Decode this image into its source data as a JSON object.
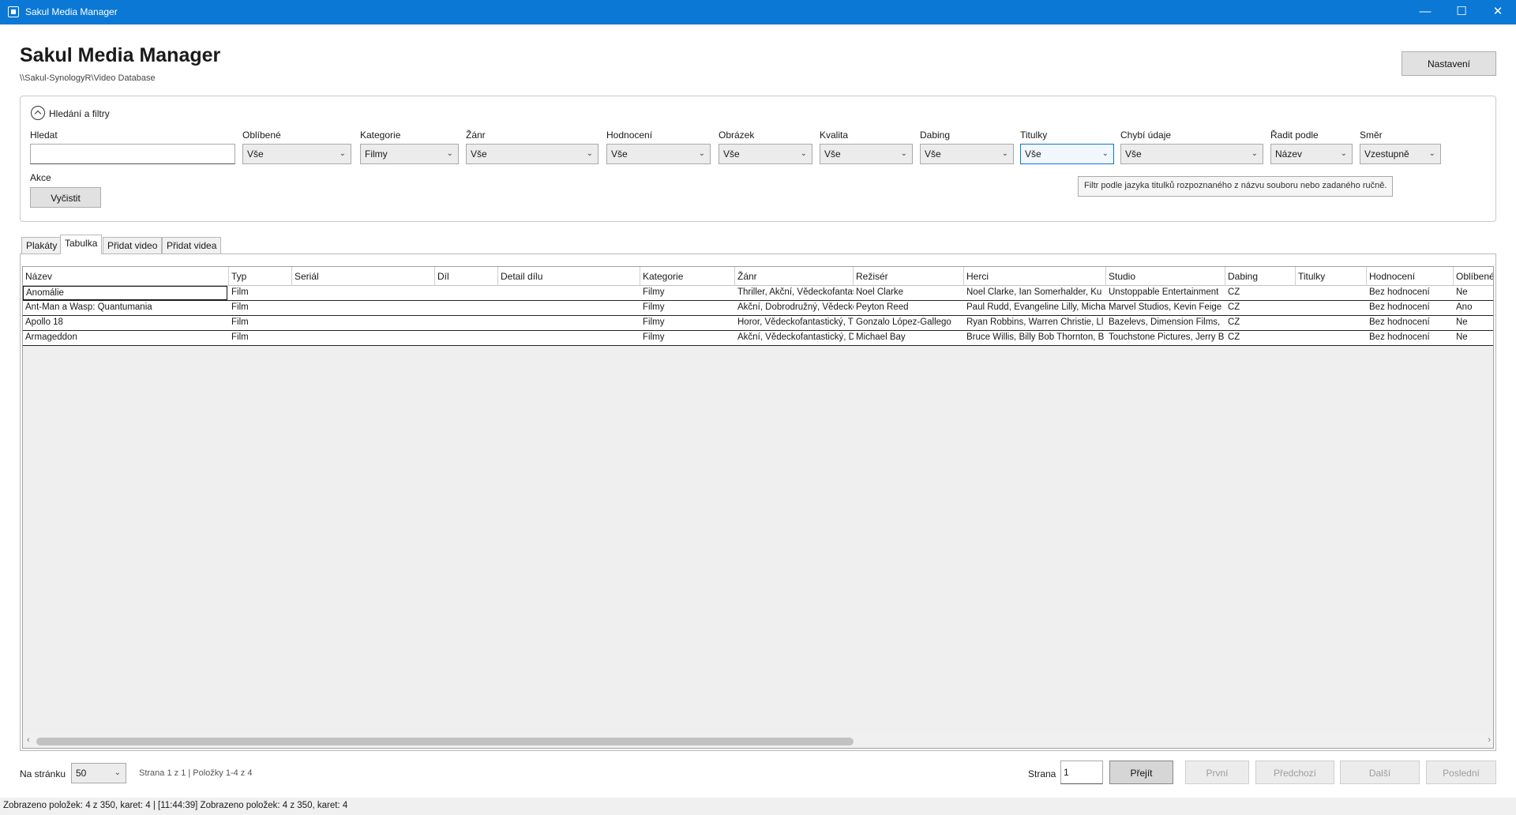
{
  "window": {
    "title": "Sakul Media Manager",
    "minimize": "—",
    "maximize": "☐",
    "close": "✕"
  },
  "header": {
    "title": "Sakul Media Manager",
    "path": "\\\\Sakul-SynologyR\\Video Database",
    "settings_label": "Nastavení"
  },
  "filters": {
    "expander_label": "Hledání a filtry",
    "search_label": "Hledat",
    "search_value": "",
    "favorites": {
      "label": "Oblíbené",
      "value": "Vše"
    },
    "category": {
      "label": "Kategorie",
      "value": "Filmy"
    },
    "genre": {
      "label": "Žánr",
      "value": "Vše"
    },
    "rating": {
      "label": "Hodnocení",
      "value": "Vše"
    },
    "image": {
      "label": "Obrázek",
      "value": "Vše"
    },
    "quality": {
      "label": "Kvalita",
      "value": "Vše"
    },
    "dubbing": {
      "label": "Dabing",
      "value": "Vše"
    },
    "subtitles": {
      "label": "Titulky",
      "value": "Vše"
    },
    "missing": {
      "label": "Chybí údaje",
      "value": "Vše"
    },
    "sort": {
      "label": "Řadit podle",
      "value": "Název"
    },
    "direction": {
      "label": "Směr",
      "value": "Vzestupně"
    },
    "actions_label": "Akce",
    "clear_label": "Vyčistit",
    "tooltip": "Filtr podle jazyka titulků rozpoznaného z názvu souboru nebo zadaného ručně."
  },
  "tabs": [
    {
      "label": "Plakáty"
    },
    {
      "label": "Tabulka"
    },
    {
      "label": "Přidat video"
    },
    {
      "label": "Přidat videa"
    }
  ],
  "table": {
    "columns": [
      "Název",
      "Typ",
      "Seriál",
      "Díl",
      "Detail dílu",
      "Kategorie",
      "Žánr",
      "Režisér",
      "Herci",
      "Studio",
      "Dabing",
      "Titulky",
      "Hodnocení",
      "Oblíbené"
    ],
    "rows": [
      [
        "Anomálie",
        "Film",
        "",
        "",
        "",
        "Filmy",
        "Thriller, Akční, Vědeckofantastický",
        "Noel Clarke",
        "Noel Clarke, Ian Somerhalder, Ku",
        "Unstoppable Entertainment",
        "CZ",
        "",
        "Bez hodnocení",
        "Ne"
      ],
      [
        "Ant-Man a Wasp: Quantumania",
        "Film",
        "",
        "",
        "",
        "Filmy",
        "Akční, Dobrodružný, Vědeckofantastický",
        "Peyton Reed",
        "Paul Rudd, Evangeline Lilly, Micha",
        "Marvel Studios, Kevin Feige",
        "CZ",
        "",
        "Bez hodnocení",
        "Ano"
      ],
      [
        "Apollo 18",
        "Film",
        "",
        "",
        "",
        "Filmy",
        "Horor, Vědeckofantastický, Thriller",
        "Gonzalo López-Gallego",
        "Ryan Robbins, Warren Christie, Ll",
        "Bazelevs, Dimension Films,",
        "CZ",
        "",
        "Bez hodnocení",
        "Ne"
      ],
      [
        "Armageddon",
        "Film",
        "",
        "",
        "",
        "Filmy",
        "Akční, Vědeckofantastický, Dobrodružný",
        "Michael Bay",
        "Bruce Willis, Billy Bob Thornton, B",
        "Touchstone Pictures, Jerry B",
        "CZ",
        "",
        "Bez hodnocení",
        "Ne"
      ]
    ]
  },
  "pagination": {
    "per_page_label": "Na stránku",
    "per_page_value": "50",
    "page_info": "Strana 1 z 1 | Položky 1-4 z 4",
    "page_label": "Strana",
    "page_value": "1",
    "go_label": "Přejít",
    "first_label": "První",
    "prev_label": "Předchozí",
    "next_label": "Další",
    "last_label": "Poslední"
  },
  "status": "Zobrazeno položek: 4 z 350, karet: 4  |  [11:44:39] Zobrazeno položek: 4 z 350, karet: 4"
}
